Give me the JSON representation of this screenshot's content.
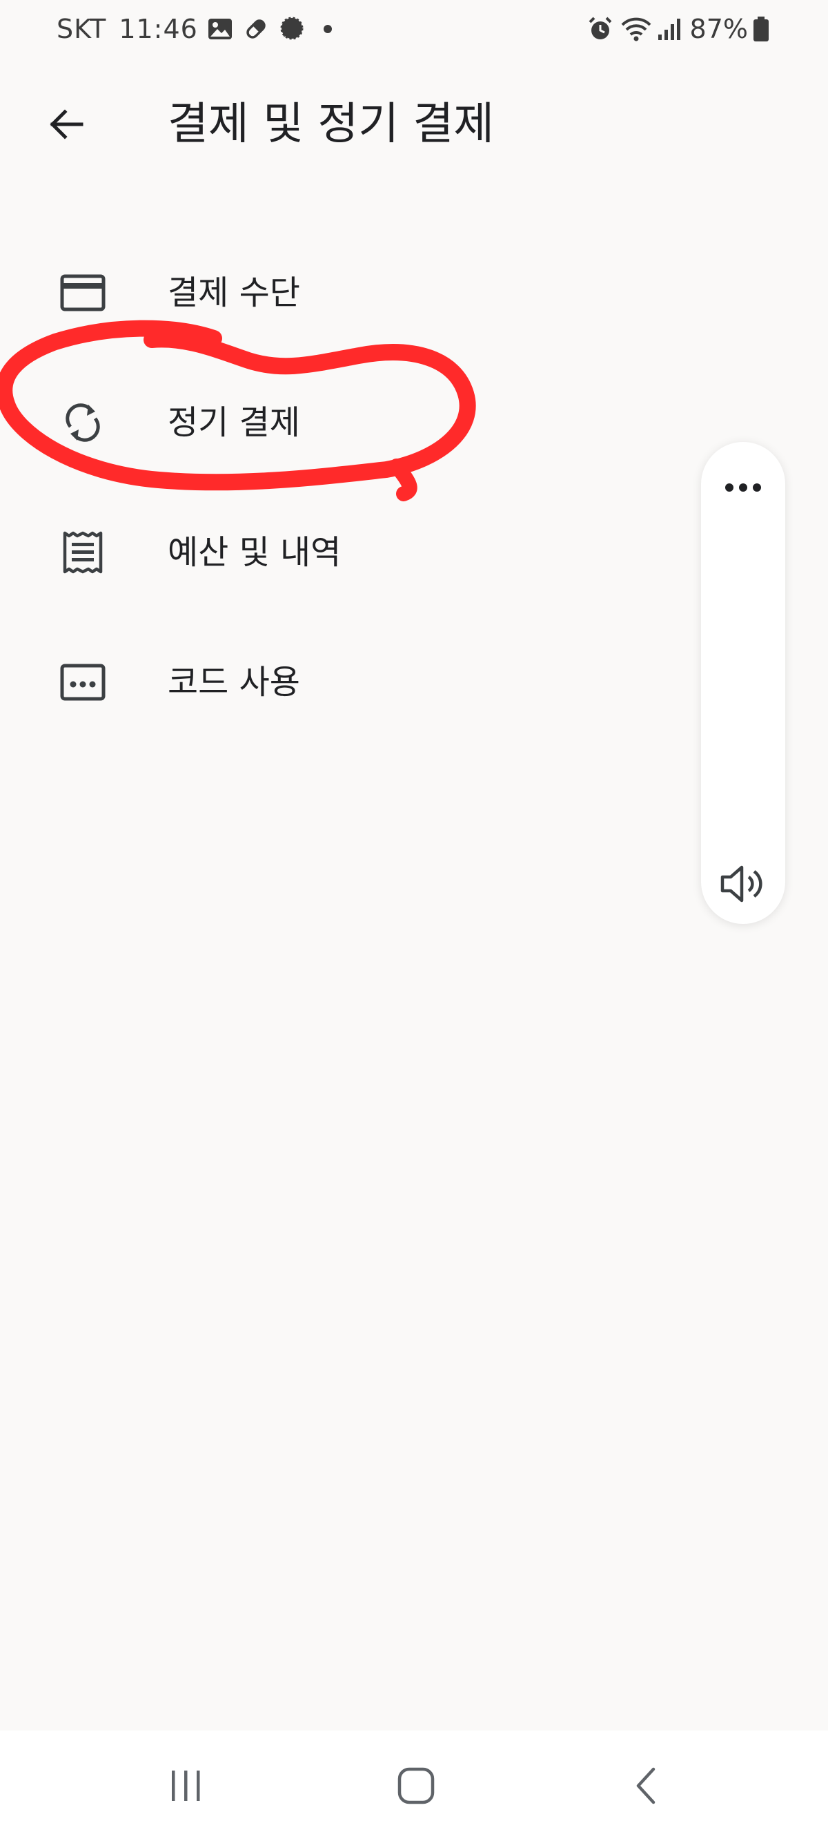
{
  "status_bar": {
    "carrier": "SKT",
    "time": "11:46",
    "battery": "87%",
    "left_icons": [
      "gallery-icon",
      "pill-icon",
      "chat-bubble-icon",
      "notification-dot-icon"
    ],
    "right_icons": [
      "alarm-icon",
      "wifi-icon",
      "signal-icon",
      "battery-icon"
    ]
  },
  "header": {
    "title": "결제 및 정기 결제",
    "back_icon": "arrow-back-icon"
  },
  "menu": {
    "items": [
      {
        "label": "결제 수단",
        "icon": "credit-card-icon"
      },
      {
        "label": "정기 결제",
        "icon": "sync-icon"
      },
      {
        "label": "예산 및 내역",
        "icon": "receipt-icon"
      },
      {
        "label": "코드 사용",
        "icon": "redeem-code-icon"
      }
    ]
  },
  "annotation": {
    "color": "#ff2a2a",
    "target": "정기 결제"
  },
  "floating_panel": {
    "top_icon": "more-horizontal-icon",
    "bottom_icon": "volume-icon"
  },
  "nav_bar": {
    "icons": [
      "recent-apps-icon",
      "home-icon",
      "back-icon"
    ]
  },
  "colors": {
    "background": "#faf9f8",
    "text": "#202124",
    "icon": "#3c4043",
    "annotation": "#ff2a2a"
  }
}
